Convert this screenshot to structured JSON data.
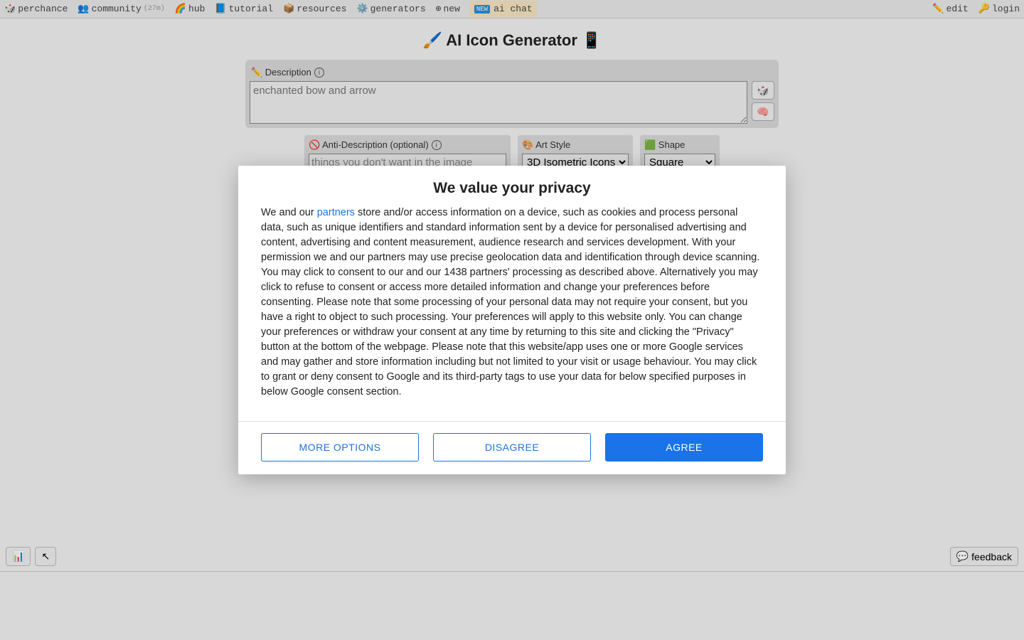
{
  "nav": {
    "perchance": "perchance",
    "community": "community",
    "community_count": "(27m)",
    "hub": "hub",
    "tutorial": "tutorial",
    "resources": "resources",
    "generators": "generators",
    "new": "new",
    "ai_chat": "ai chat",
    "new_badge": "NEW",
    "edit": "edit",
    "login": "login"
  },
  "page": {
    "title_prefix": "🖌️ ",
    "title": "AI Icon Generator",
    "title_suffix": " 📱"
  },
  "form": {
    "description_label": "✏️ Description",
    "description_placeholder": "enchanted bow and arrow",
    "dice_btn": "🎲",
    "brain_btn": "🧠",
    "anti_label": "🚫 Anti-Description (optional)",
    "anti_placeholder": "things you don't want in the image",
    "artstyle_label": "🎨 Art Style",
    "artstyle_value": "3D Isometric Icons",
    "shape_label": "🟩 Shape",
    "shape_value": "Square"
  },
  "bottom": {
    "stats_icon": "📊",
    "arrow_icon": "↖",
    "feedback_icon": "💬",
    "feedback": "feedback"
  },
  "modal": {
    "title": "We value your privacy",
    "body_prefix": "We and our ",
    "partners_link": "partners",
    "body_rest": " store and/or access information on a device, such as cookies and process personal data, such as unique identifiers and standard information sent by a device for personalised advertising and content, advertising and content measurement, audience research and services development. With your permission we and our partners may use precise geolocation data and identification through device scanning. You may click to consent to our and our 1438 partners' processing as described above. Alternatively you may click to refuse to consent or access more detailed information and change your preferences before consenting. Please note that some processing of your personal data may not require your consent, but you have a right to object to such processing. Your preferences will apply to this website only. You can change your preferences or withdraw your consent at any time by returning to this site and clicking the \"Privacy\" button at the bottom of the webpage. Please note that this website/app uses one or more Google services and may gather and store information including but not limited to your visit or usage behaviour. You may click to grant or deny consent to Google and its third-party tags to use your data for below specified purposes in below Google consent section.",
    "more_options": "MORE OPTIONS",
    "disagree": "DISAGREE",
    "agree": "AGREE"
  }
}
